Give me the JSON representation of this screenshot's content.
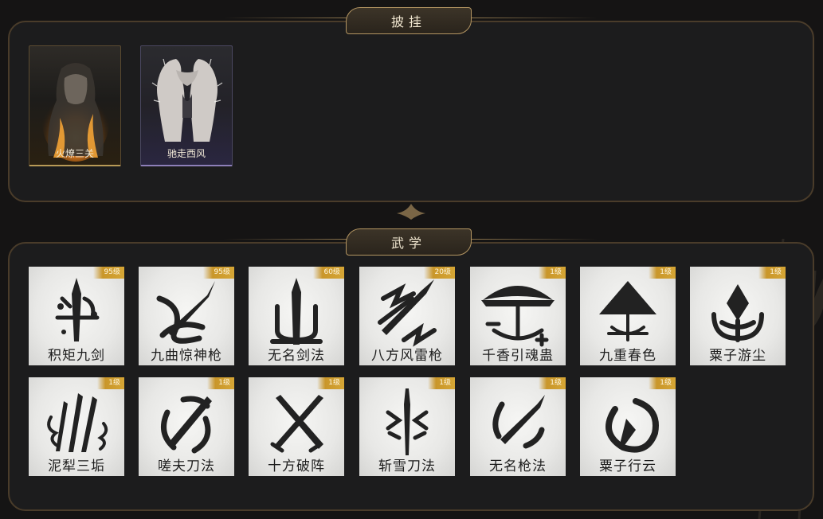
{
  "sections": {
    "cloak": {
      "title": "披挂",
      "items": [
        {
          "name": "火燎三关",
          "accent": "#b89a56"
        },
        {
          "name": "驰走西风",
          "accent": "#8d7fb8"
        }
      ]
    },
    "martial": {
      "title": "武学",
      "items": [
        {
          "name": "积矩九剑",
          "level": "95级",
          "icon": "sword-runes-icon"
        },
        {
          "name": "九曲惊神枪",
          "level": "95级",
          "icon": "spear-swirl-icon"
        },
        {
          "name": "无名剑法",
          "level": "60级",
          "icon": "trident-sword-icon"
        },
        {
          "name": "八方风雷枪",
          "level": "20级",
          "icon": "lightning-spear-icon"
        },
        {
          "name": "千香引魂蛊",
          "level": "1级",
          "icon": "umbrella-icon"
        },
        {
          "name": "九重春色",
          "level": "1级",
          "icon": "parasol-icon"
        },
        {
          "name": "粟子游尘",
          "level": "1级",
          "icon": "dart-vortex-icon"
        },
        {
          "name": "泥犁三垢",
          "level": "1级",
          "icon": "flame-blades-icon"
        },
        {
          "name": "嗟夫刀法",
          "level": "1级",
          "icon": "blade-circle-icon"
        },
        {
          "name": "十方破阵",
          "level": "1级",
          "icon": "crossed-swords-icon"
        },
        {
          "name": "斩雪刀法",
          "level": "1级",
          "icon": "snow-sword-icon"
        },
        {
          "name": "无名枪法",
          "level": "1级",
          "icon": "spear-slash-icon"
        },
        {
          "name": "粟子行云",
          "level": "1级",
          "icon": "dart-ring-icon"
        }
      ]
    }
  }
}
